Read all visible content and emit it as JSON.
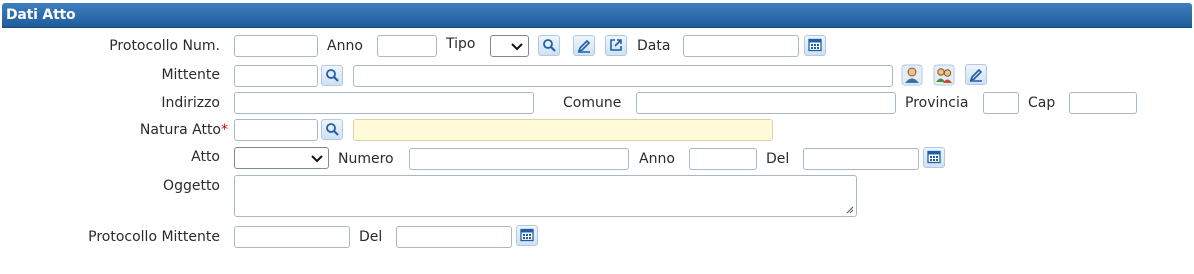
{
  "panel": {
    "title": "Dati Atto"
  },
  "row1": {
    "protocollo_label": "Protocollo Num.",
    "anno_label": "Anno",
    "tipo_label": "Tipo",
    "data_label": "Data"
  },
  "row2": {
    "mittente_label": "Mittente"
  },
  "row3": {
    "indirizzo_label": "Indirizzo",
    "comune_label": "Comune",
    "provincia_label": "Provincia",
    "cap_label": "Cap"
  },
  "row4": {
    "natura_label": "Natura Atto",
    "required_mark": "*"
  },
  "row5": {
    "atto_label": "Atto",
    "numero_label": "Numero",
    "anno_label": "Anno",
    "del_label": "Del"
  },
  "row6": {
    "oggetto_label": "Oggetto"
  },
  "row7": {
    "protocollo_mittente_label": "Protocollo Mittente",
    "del_label": "Del"
  },
  "icons": {
    "search": "search-icon",
    "edit": "pencil-icon",
    "open": "external-link-icon",
    "calendar": "calendar-icon",
    "person": "person-icon",
    "people": "people-icon",
    "chevron": "chevron-down-icon"
  },
  "colors": {
    "header_top": "#3f7fbf",
    "header_bottom": "#1f5c9c",
    "required_field_bg": "#fffbd9",
    "icon_blue": "#1e5fa8"
  }
}
